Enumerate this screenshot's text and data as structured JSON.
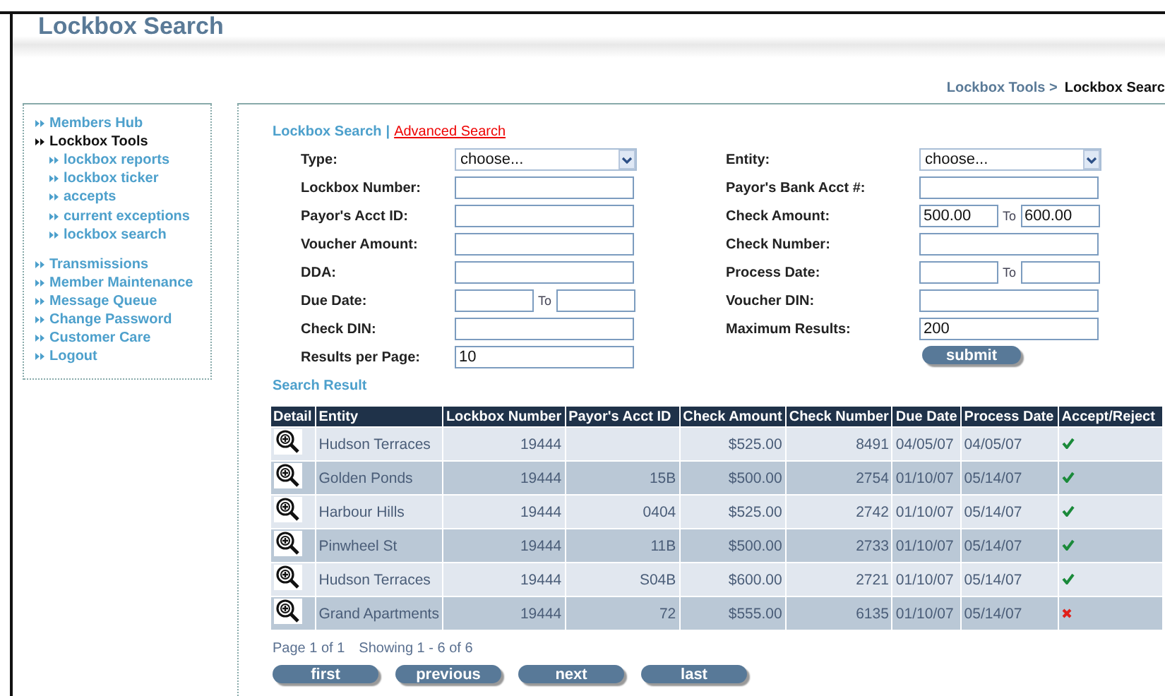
{
  "header": {
    "title": "Lockbox Search"
  },
  "breadcrumb": {
    "parent": "Lockbox Tools >",
    "current": "Lockbox Searc"
  },
  "sidebar": {
    "items": [
      {
        "label": "Members Hub",
        "selected": false
      },
      {
        "label": "Lockbox Tools",
        "selected": true,
        "children": [
          {
            "label": "lockbox reports",
            "selected": false
          },
          {
            "label": "lockbox ticker",
            "selected": false
          },
          {
            "label": "accepts",
            "selected": false
          },
          {
            "label": "current exceptions",
            "selected": false
          },
          {
            "label": "lockbox search",
            "selected": false
          }
        ]
      },
      {
        "label": "Transmissions",
        "selected": false
      },
      {
        "label": "Member Maintenance",
        "selected": false
      },
      {
        "label": "Message Queue",
        "selected": false
      },
      {
        "label": "Change Password",
        "selected": false
      },
      {
        "label": "Customer Care",
        "selected": false
      },
      {
        "label": "Logout",
        "selected": false
      }
    ]
  },
  "search_tabs": [
    {
      "label": "Lockbox Search",
      "selected": true
    },
    {
      "label": "Advanced Search",
      "selected": false
    }
  ],
  "tab_separator": "|",
  "form": {
    "left": [
      {
        "kind": "select",
        "label": "Type:",
        "value": "choose..."
      },
      {
        "kind": "text",
        "label": "Lockbox Number:"
      },
      {
        "kind": "text",
        "label": "Payor's Acct ID:"
      },
      {
        "kind": "text",
        "label": "Voucher Amount:"
      },
      {
        "kind": "text",
        "label": "DDA:"
      },
      {
        "kind": "range",
        "label": "Due Date:",
        "to": "To"
      },
      {
        "kind": "text",
        "label": "Check DIN:"
      },
      {
        "kind": "text",
        "label": "Results per Page:",
        "value": "10"
      }
    ],
    "right": [
      {
        "kind": "select",
        "label": "Entity:",
        "value": "choose..."
      },
      {
        "kind": "text",
        "label": "Payor's Bank Acct #:"
      },
      {
        "kind": "range",
        "label": "Check Amount:",
        "from_value": "500.00",
        "to": "To",
        "to_value": "600.00"
      },
      {
        "kind": "text",
        "label": "Check Number:"
      },
      {
        "kind": "range",
        "label": "Process Date:",
        "to": "To"
      },
      {
        "kind": "text",
        "label": "Voucher DIN:"
      },
      {
        "kind": "text",
        "label": "Maximum Results:",
        "value": "200"
      }
    ],
    "submit": "submit"
  },
  "results": {
    "title": "Search Result",
    "columns": [
      "Detail",
      "Entity",
      "Lockbox Number",
      "Payor's Acct ID",
      "Check Amount",
      "Check Number",
      "Due Date",
      "Process Date",
      "Accept/Reject"
    ],
    "rows": [
      {
        "entity": "Hudson Terraces",
        "lockbox": "19444",
        "payor": "",
        "amount": "$525.00",
        "check": "8491",
        "due": "04/05/07",
        "process": "04/05/07",
        "accepted": true
      },
      {
        "entity": "Golden Ponds",
        "lockbox": "19444",
        "payor": "15B",
        "amount": "$500.00",
        "check": "2754",
        "due": "01/10/07",
        "process": "05/14/07",
        "accepted": true
      },
      {
        "entity": "Harbour Hills",
        "lockbox": "19444",
        "payor": "0404",
        "amount": "$525.00",
        "check": "2742",
        "due": "01/10/07",
        "process": "05/14/07",
        "accepted": true
      },
      {
        "entity": "Pinwheel St",
        "lockbox": "19444",
        "payor": "11B",
        "amount": "$500.00",
        "check": "2733",
        "due": "01/10/07",
        "process": "05/14/07",
        "accepted": true
      },
      {
        "entity": "Hudson Terraces",
        "lockbox": "19444",
        "payor": "S04B",
        "amount": "$600.00",
        "check": "2721",
        "due": "01/10/07",
        "process": "05/14/07",
        "accepted": true
      },
      {
        "entity": "Grand Apartments",
        "lockbox": "19444",
        "payor": "72",
        "amount": "$555.00",
        "check": "6135",
        "due": "01/10/07",
        "process": "05/14/07",
        "accepted": false
      }
    ],
    "page_info": "Page 1 of 1",
    "showing": "Showing 1 - 6 of 6",
    "pager": [
      "first",
      "previous",
      "next",
      "last"
    ]
  }
}
